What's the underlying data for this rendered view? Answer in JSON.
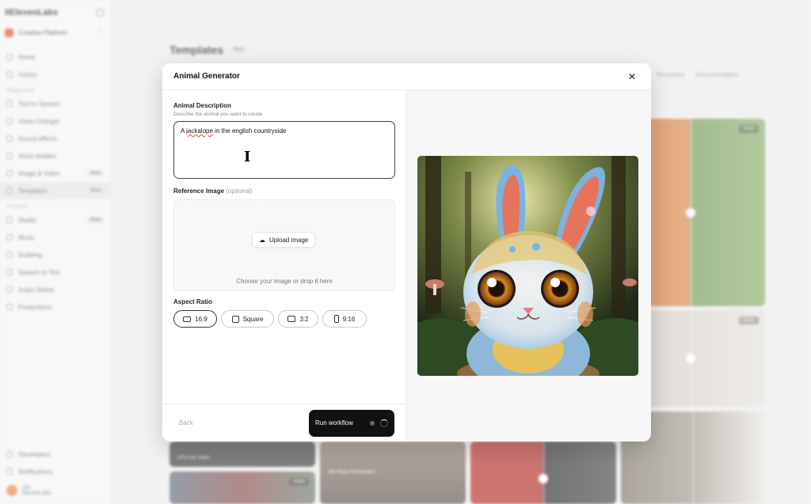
{
  "sidebar": {
    "brand": "IIElevenLabs",
    "workspace": "Creative Platform",
    "top_items": [
      {
        "label": "Home"
      },
      {
        "label": "Voices"
      }
    ],
    "section_playground": "Playground",
    "playground_items": [
      {
        "label": "Text to Speech",
        "badge": ""
      },
      {
        "label": "Voice Changer",
        "badge": ""
      },
      {
        "label": "Sound effects",
        "badge": ""
      },
      {
        "label": "Voice Isolator",
        "badge": ""
      },
      {
        "label": "Image & Video",
        "badge": "Beta"
      },
      {
        "label": "Templates",
        "badge": "Beta"
      }
    ],
    "section_products": "Products",
    "product_items": [
      {
        "label": "Studio",
        "badge": "Beta"
      },
      {
        "label": "Music",
        "badge": ""
      },
      {
        "label": "Dubbing",
        "badge": ""
      },
      {
        "label": "Speech to Text",
        "badge": ""
      },
      {
        "label": "Audio Native",
        "badge": ""
      },
      {
        "label": "Productions",
        "badge": ""
      }
    ],
    "bottom_items": [
      {
        "label": "Developers"
      },
      {
        "label": "Notifications"
      }
    ],
    "user_name": "Jim",
    "user_org": "ElevenLabs"
  },
  "background": {
    "page_title": "Templates",
    "page_badge": "Beta",
    "links": [
      "Templates",
      "Documentation"
    ],
    "tiles": [
      {
        "tag": "Video",
        "caption": ""
      },
      {
        "tag": "Video",
        "caption": ""
      },
      {
        "tag": "",
        "caption": "UFO Car Video"
      },
      {
        "tag": "",
        "caption": "Old Photo Restoration"
      },
      {
        "tag": "Video",
        "caption": ""
      }
    ]
  },
  "modal": {
    "title": "Animal Generator",
    "description_label": "Animal Description",
    "description_help": "Describe the animal you want to create",
    "description_value_pre": "A ",
    "description_value_spell": "jackalope",
    "description_value_post": " in the english countryside",
    "reference_label": "Reference Image",
    "reference_optional": "(optional)",
    "upload_button": "Upload image",
    "upload_hint": "Choose your image or drop it here",
    "aspect_label": "Aspect Ratio",
    "aspect_options": [
      {
        "label": "16:9",
        "selected": true
      },
      {
        "label": "Square",
        "selected": false
      },
      {
        "label": "3:2",
        "selected": false
      },
      {
        "label": "9:16",
        "selected": false
      }
    ],
    "back_label": "Back",
    "run_label": "Run workflow"
  },
  "colors": {
    "accent_dark": "#111111",
    "brand_red": "#e14b3b"
  }
}
